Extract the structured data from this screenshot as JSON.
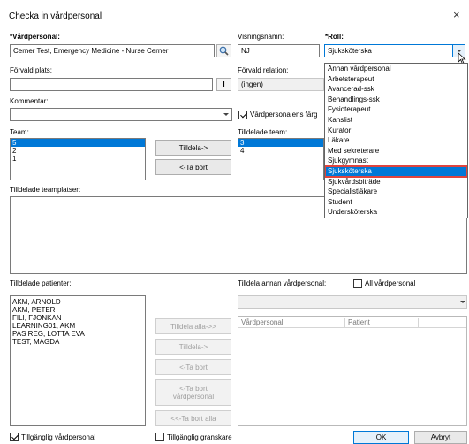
{
  "window": {
    "title": "Checka in vårdpersonal",
    "close_glyph": "×"
  },
  "staff": {
    "label": "*Vårdpersonal:",
    "value": "Cerner Test, Emergency Medicine - Nurse Cerner"
  },
  "display_name": {
    "label": "Visningsnamn:",
    "value": "NJ"
  },
  "role": {
    "label": "*Roll:",
    "value": "Sjuksköterska",
    "options": [
      "Annan vårdpersonal",
      "Arbetsterapeut",
      "Avancerad-ssk",
      "Behandlings-ssk",
      "Fysioterapeut",
      "Kanslist",
      "Kurator",
      "Läkare",
      "Med sekreterare",
      "Sjukgymnast",
      "Sjuksköterska",
      "Sjukvårdsbiträde",
      "Specialistläkare",
      "Student",
      "Undersköterska"
    ],
    "highlighted_index": 10
  },
  "default_place": {
    "label": "Förvald plats:",
    "button": "I"
  },
  "default_relation": {
    "label": "Förvald relation:",
    "value": "(ingen)"
  },
  "comment": {
    "label": "Kommentar:"
  },
  "color_checkbox": {
    "label": "Vårdpersonalens färg"
  },
  "team": {
    "label": "Team:",
    "items": [
      "5",
      "2",
      "1"
    ]
  },
  "assign_btn": "Tilldela->",
  "remove_btn": "<-Ta bort",
  "assigned_team": {
    "label": "Tilldelade team:",
    "items": [
      "3",
      "4"
    ]
  },
  "team_places": {
    "label": "Tilldelade teamplatser:"
  },
  "assigned_patients": {
    "label": "Tilldelade patienter:",
    "items": [
      "AKM, ARNOLD",
      "AKM, PETER",
      "FILI, FJONKAN",
      "LEARNING01, AKM",
      "PAS REG, LOTTA EVA",
      "TEST, MAGDA"
    ]
  },
  "patient_buttons": {
    "assign_all": "Tilldela alla->>",
    "assign": "Tilldela->",
    "remove": "<-Ta bort",
    "remove_staff_1": "<-Ta bort",
    "remove_staff_2": "vårdpersonal",
    "remove_all": "<<-Ta bort alla"
  },
  "other_staff": {
    "label": "Tilldela annan vårdpersonal:",
    "all_label": "All vårdpersonal"
  },
  "grid_headers": {
    "staff": "Vårdpersonal",
    "patient": "Patient"
  },
  "footer": {
    "available_staff": "Tillgänglig vårdpersonal",
    "available_reviewer": "Tillgänglig granskare",
    "ok": "OK",
    "cancel": "Avbryt"
  }
}
